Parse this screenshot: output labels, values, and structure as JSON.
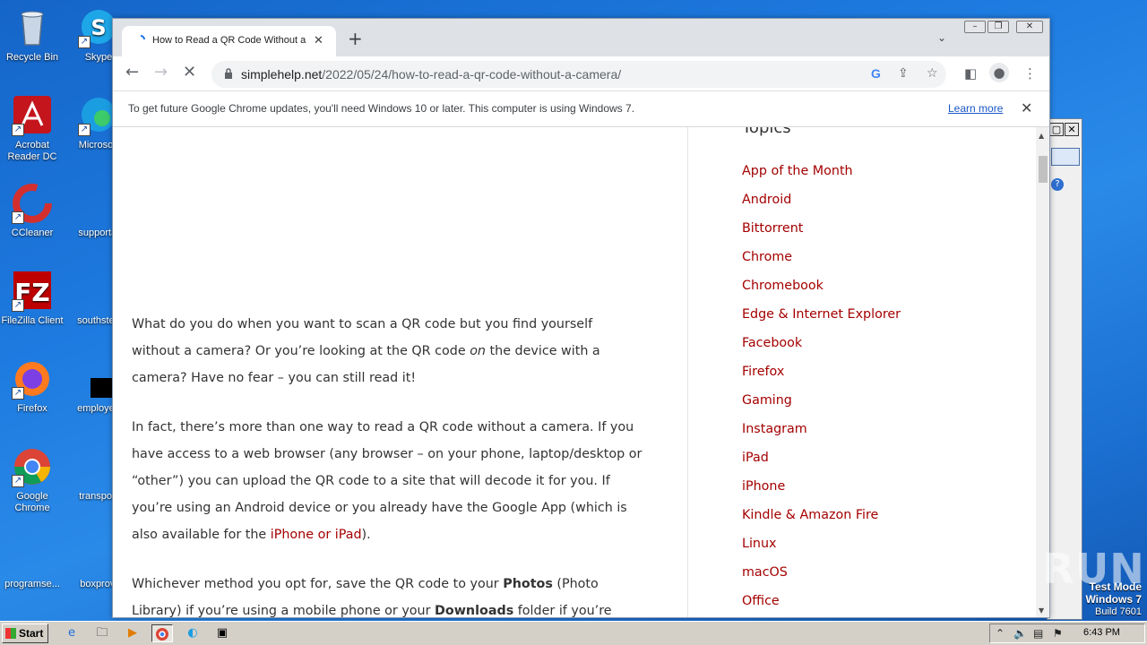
{
  "desktop": {
    "icons": [
      {
        "label": "Recycle Bin",
        "icon": "recycle-bin-icon"
      },
      {
        "label": "Skype",
        "icon": "skype-icon"
      },
      {
        "label": "Acrobat Reader DC",
        "icon": "acrobat-icon"
      },
      {
        "label": "Microsoft",
        "icon": "edge-icon"
      },
      {
        "label": "CCleaner",
        "icon": "ccleaner-icon"
      },
      {
        "label": "supportal",
        "icon": "file-icon"
      },
      {
        "label": "FileZilla Client",
        "icon": "filezilla-icon"
      },
      {
        "label": "southstep",
        "icon": "file-icon"
      },
      {
        "label": "Firefox",
        "icon": "firefox-icon"
      },
      {
        "label": "employee",
        "icon": "black-file-icon"
      },
      {
        "label": "Google Chrome",
        "icon": "chrome-icon"
      },
      {
        "label": "transport",
        "icon": "file-icon"
      },
      {
        "label": "programse...",
        "icon": "file-icon"
      },
      {
        "label": "boxprovi",
        "icon": "file-icon"
      }
    ]
  },
  "browser": {
    "tab_title": "How to Read a QR Code Without a Camera",
    "tab_close": "✕",
    "new_tab": "+",
    "url_domain": "simplehelp.net",
    "url_path": "/2022/05/24/how-to-read-a-qr-code-without-a-camera/",
    "infobar_text": "To get future Google Chrome updates, you'll need Windows 10 or later. This computer is using Windows 7.",
    "infobar_link": "Learn more"
  },
  "article": {
    "p1_a": "What do you do when you want to scan a QR code but you find yourself without a camera? Or you’re looking at the QR code ",
    "p1_em": "on",
    "p1_b": " the device with a camera? Have no fear – you can still read it!",
    "p2_a": "In fact, there’s more than one way to read a QR code without a camera. If you have access to a web browser (any browser – on your phone, laptop/desktop or “other”) you can upload the QR code to a site that will decode it for you. If you’re using an Android device or you already have the Google App (which is also available for the ",
    "p2_link": "iPhone or iPad",
    "p2_b": ").",
    "p3_a": "Whichever method you opt for, save the QR code to your ",
    "p3_strong1": "Photos",
    "p3_b": " (Photo Library) if you’re using a mobile phone or your ",
    "p3_strong2": "Downloads",
    "p3_c": " folder if you’re using a"
  },
  "sidebar": {
    "heading": "Topics",
    "topics": [
      "App of the Month",
      "Android",
      "Bittorrent",
      "Chrome",
      "Chromebook",
      "Edge & Internet Explorer",
      "Facebook",
      "Firefox",
      "Gaming",
      "Instagram",
      "iPad",
      "iPhone",
      "Kindle & Amazon Fire",
      "Linux",
      "macOS",
      "Office"
    ]
  },
  "taskbar": {
    "start_label": "Start",
    "clock": "6:43 PM"
  },
  "watermark": "ANY RUN",
  "test_mode": {
    "line1": "Test Mode",
    "line2": "Windows 7",
    "line3": "Build 7601"
  }
}
